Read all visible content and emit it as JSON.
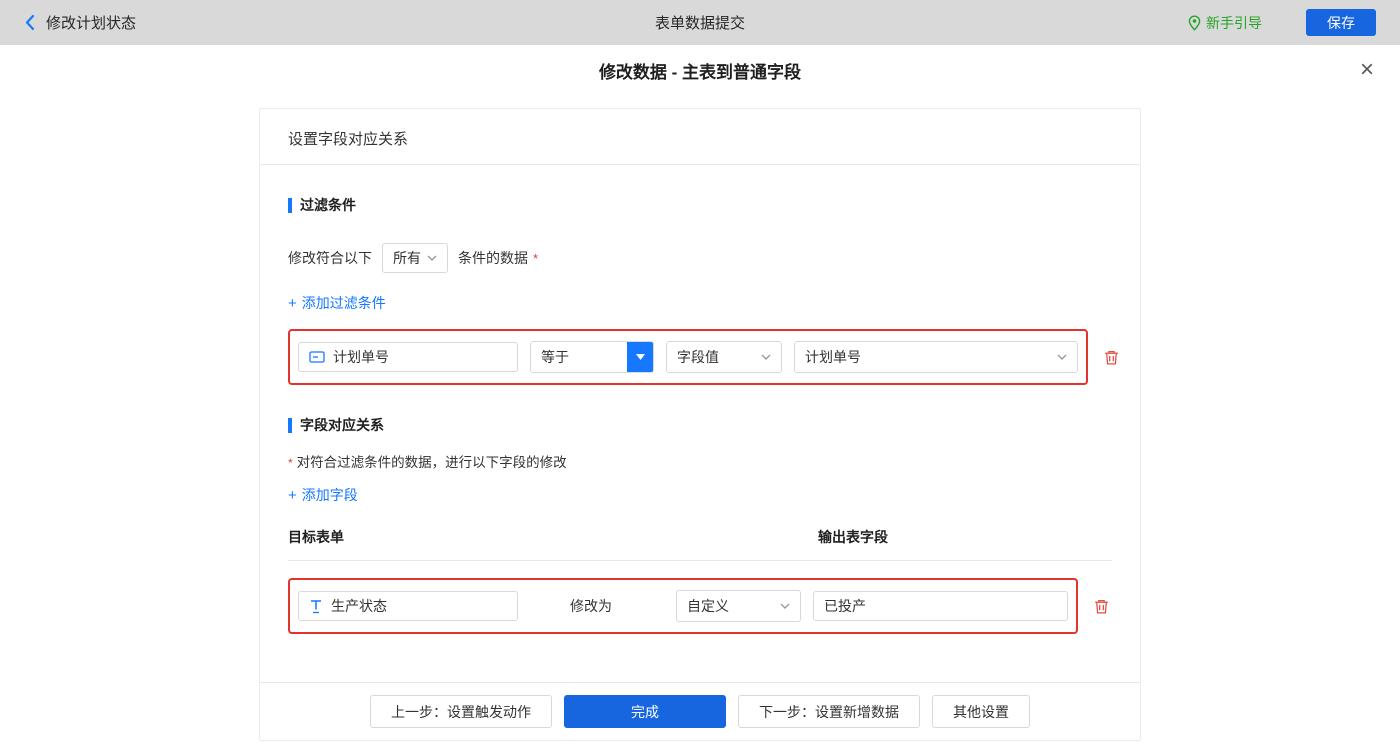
{
  "header": {
    "back_label": "修改计划状态",
    "title": "表单数据提交",
    "guide_label": "新手引导",
    "save_label": "保存"
  },
  "dialog": {
    "title": "修改数据 - 主表到普通字段",
    "close_glyph": "×"
  },
  "panel": {
    "title": "设置字段对应关系",
    "filter_section": {
      "heading": "过滤条件",
      "prefix": "修改符合以下",
      "match_select": "所有",
      "suffix": "条件的数据",
      "required_mark": "*",
      "add_label": "添加过滤条件",
      "row": {
        "field": "计划单号",
        "operator": "等于",
        "value_type": "字段值",
        "value_field": "计划单号"
      }
    },
    "mapping_section": {
      "heading": "字段对应关系",
      "required_mark": "*",
      "description": "对符合过滤条件的数据，进行以下字段的修改",
      "add_label": "添加字段",
      "col_left": "目标表单",
      "col_right": "输出表字段",
      "row": {
        "field": "生产状态",
        "middle_label": "修改为",
        "value_type": "自定义",
        "value": "已投产"
      }
    }
  },
  "footer": {
    "prev_label": "上一步：设置触发动作",
    "done_label": "完成",
    "next_label": "下一步：设置新增数据",
    "other_label": "其他设置"
  },
  "icons": {
    "plus": "+"
  },
  "colors": {
    "topbar_gray": "#d9d9d9",
    "accent_blue": "#1766e0",
    "link_blue": "#1677ff",
    "guide_green": "#27a327",
    "danger_red": "#e0342c"
  }
}
